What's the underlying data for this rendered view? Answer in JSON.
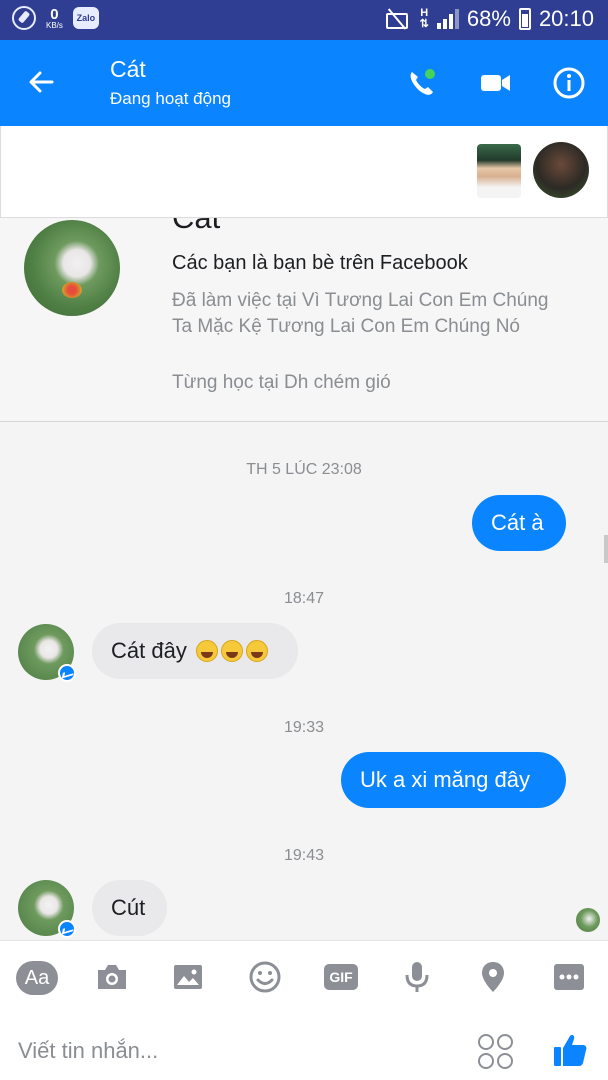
{
  "status_bar": {
    "data_speed_value": "0",
    "data_speed_unit": "KB/s",
    "zalo_label": "Zalo",
    "network_type": "H",
    "battery_percent": "68%",
    "time": "20:10"
  },
  "header": {
    "title": "Cát",
    "subtitle": "Đang hoạt động",
    "icons": [
      "back-arrow-icon",
      "phone-icon",
      "video-camera-icon",
      "info-icon"
    ],
    "accent_color": "#0a84ff"
  },
  "profile": {
    "name_partial": "Cát",
    "friends_text": "Các bạn là bạn bè trên Facebook",
    "work_text": "Đã làm việc tại Vì Tương Lai Con Em Chúng Ta Mặc Kệ Tương Lai Con Em Chúng Nó",
    "school_text": "Từng học tại Dh chém gió"
  },
  "messages": {
    "ts1": "TH 5 LÚC 23:08",
    "m1": "Cát à",
    "ts2": "18:47",
    "m2": "Cát đây",
    "m2_emoji": [
      "laughing-emoji",
      "laughing-emoji",
      "laughing-emoji"
    ],
    "ts3": "19:33",
    "m3": "Uk a xi măng đây",
    "ts4": "19:43",
    "m4": "Cút"
  },
  "composer": {
    "aa_label": "Aa",
    "gif_label": "GIF",
    "placeholder": "Viết tin nhắn...",
    "tool_icons": [
      "text-style-icon",
      "camera-icon",
      "image-icon",
      "emoji-icon",
      "gif-icon",
      "microphone-icon",
      "location-pin-icon",
      "more-icon"
    ],
    "icon_color": "#8c9096"
  }
}
